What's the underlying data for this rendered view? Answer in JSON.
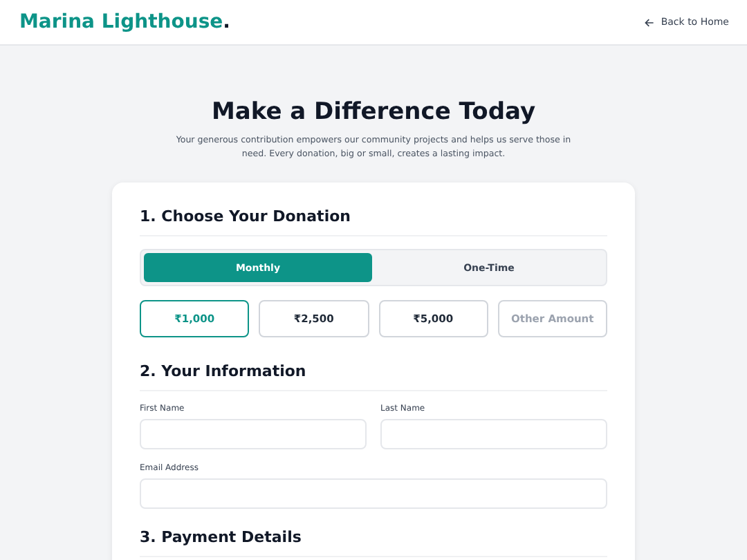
{
  "header": {
    "logo": "Marina Lighthouse",
    "logo_dot": ".",
    "back_link": "Back to Home"
  },
  "hero": {
    "title": "Make a Difference Today",
    "subtitle": "Your generous contribution empowers our community projects and helps us serve those in need. Every donation, big or small, creates a lasting impact."
  },
  "donation": {
    "heading": "1. Choose Your Donation",
    "frequency": [
      {
        "label": "Monthly",
        "selected": true
      },
      {
        "label": "One-Time",
        "selected": false
      }
    ],
    "amounts": [
      {
        "label": "₹1,000",
        "selected": true
      },
      {
        "label": "₹2,500",
        "selected": false
      },
      {
        "label": "₹5,000",
        "selected": false
      }
    ],
    "other_amount": {
      "placeholder": "Other Amount"
    }
  },
  "information": {
    "heading": "2. Your Information",
    "fields": [
      {
        "label": "First Name"
      },
      {
        "label": "Last Name"
      },
      {
        "label": "Email Address"
      }
    ]
  },
  "payment": {
    "heading": "3. Payment Details"
  }
}
